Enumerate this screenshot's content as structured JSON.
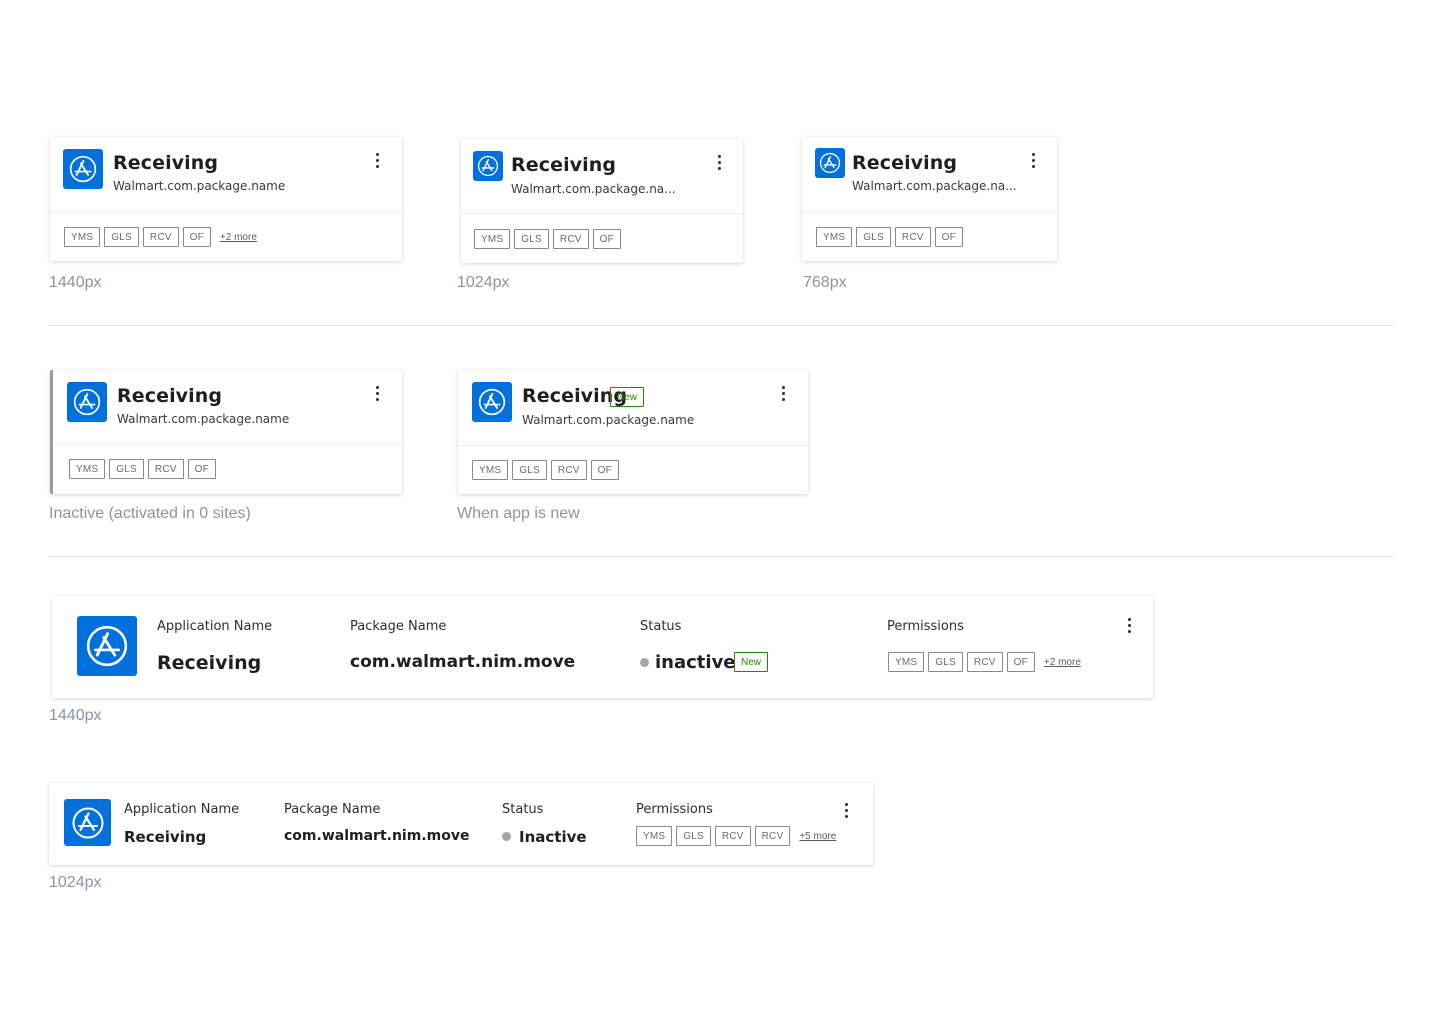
{
  "colors": {
    "icon_bg": "#0071dc",
    "new_badge": "#2a8703",
    "caption": "#8a94a6",
    "status_dot": "#a6a6a6"
  },
  "icon_name": "app-store-icon",
  "cards": [
    {
      "title": "Receiving",
      "package": "Walmart.com.package.name",
      "tags": [
        "YMS",
        "GLS",
        "RCV",
        "OF"
      ],
      "more": "+2 more",
      "caption": "1440px"
    },
    {
      "title": "Receiving",
      "package": "Walmart.com.package.na...",
      "tags": [
        "YMS",
        "GLS",
        "RCV",
        "OF"
      ],
      "caption": "1024px"
    },
    {
      "title": "Receiving",
      "package": "Walmart.com.package.na...",
      "tags": [
        "YMS",
        "GLS",
        "RCV",
        "OF"
      ],
      "caption": "768px"
    },
    {
      "title": "Receiving",
      "package": "Walmart.com.package.name",
      "tags": [
        "YMS",
        "GLS",
        "RCV",
        "OF"
      ],
      "caption": "Inactive (activated in 0 sites)"
    },
    {
      "title": "Receiving",
      "badge": "New",
      "package": "Walmart.com.package.name",
      "tags": [
        "YMS",
        "GLS",
        "RCV",
        "OF"
      ],
      "caption": "When app is new"
    }
  ],
  "rows": [
    {
      "labels": {
        "app": "Application Name",
        "pkg": "Package Name",
        "status": "Status",
        "perms": "Permissions"
      },
      "app": "Receiving",
      "pkg": "com.walmart.nim.move",
      "status": "inactive",
      "badge": "New",
      "tags": [
        "YMS",
        "GLS",
        "RCV",
        "OF"
      ],
      "more": "+2 more",
      "caption": "1440px"
    },
    {
      "labels": {
        "app": "Application Name",
        "pkg": "Package Name",
        "status": "Status",
        "perms": "Permissions"
      },
      "app": "Receiving",
      "pkg": "com.walmart.nim.move",
      "status": "Inactive",
      "tags": [
        "YMS",
        "GLS",
        "RCV",
        "RCV"
      ],
      "more": "+5 more",
      "caption": "1024px"
    }
  ]
}
